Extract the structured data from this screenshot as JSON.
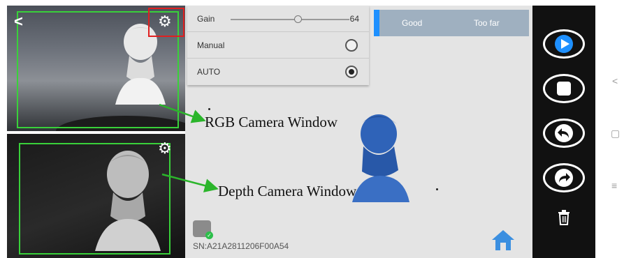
{
  "camera_panels": {
    "back_glyph": "<",
    "rgb_gear_glyph": "⚙",
    "depth_gear_glyph": "⚙"
  },
  "settings_panel": {
    "gain_label": "Gain",
    "gain_value": "64",
    "manual_label": "Manual",
    "auto_label": "AUTO",
    "selected_mode": "AUTO"
  },
  "distance_indicator": {
    "good_label": "Good",
    "too_far_label": "Too far",
    "accent_color": "#1e90ff"
  },
  "annotations": {
    "rgb_label": "RGB Camera Window",
    "depth_label": "Depth Camera Window",
    "arrow_color": "#2bb52b",
    "box_color": "#39d13a",
    "highlight_color": "#e02020"
  },
  "device": {
    "serial_number": "SN:A21A2811206F00A54",
    "connected": true
  },
  "controls": {
    "play_icon": "play-icon",
    "stop_icon": "stop-icon",
    "undo_icon": "undo-icon",
    "redo_icon": "redo-icon",
    "delete_icon": "trash-icon",
    "home_icon": "home-icon",
    "play_color": "#1e90ff"
  },
  "android_nav": {
    "back_glyph": "<",
    "recents_glyph": "▢",
    "menu_glyph": "≡"
  }
}
